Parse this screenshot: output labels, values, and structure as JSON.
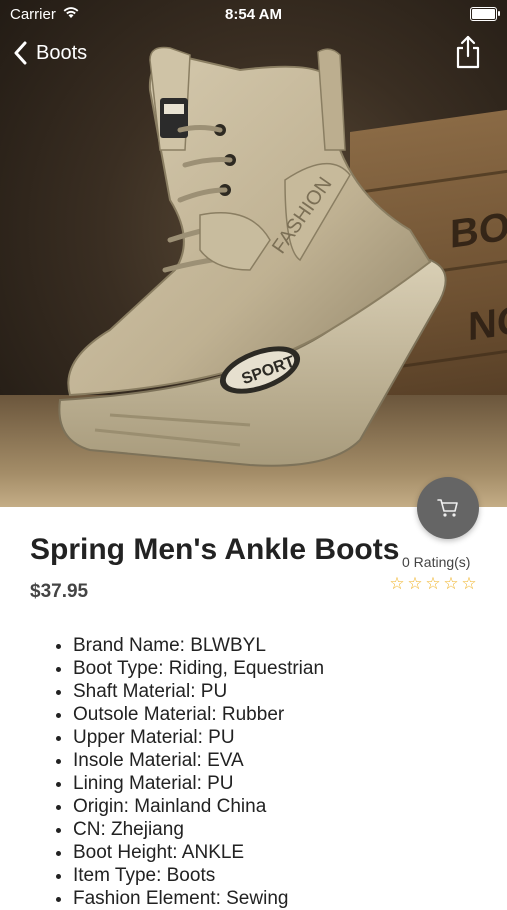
{
  "status_bar": {
    "carrier": "Carrier",
    "time": "8:54 AM"
  },
  "nav": {
    "back_label": "Boots",
    "share_icon": "share-icon"
  },
  "hero": {
    "crate_text_top": "BOX",
    "crate_text_bottom": "NO"
  },
  "product": {
    "title": "Spring Men's Ankle Boots",
    "price": "$37.95",
    "rating_count": "0 Rating(s)",
    "stars": [
      "☆",
      "☆",
      "☆",
      "☆",
      "☆"
    ],
    "cart_icon": "cart-icon",
    "features": [
      "Brand Name: BLWBYL",
      "Boot Type: Riding, Equestrian",
      "Shaft Material: PU",
      "Outsole Material: Rubber",
      "Upper Material: PU",
      "Insole Material: EVA",
      "Lining Material: PU",
      "Origin: Mainland China",
      "CN: Zhejiang",
      "Boot Height: ANKLE",
      "Item Type: Boots",
      "Fashion Element: Sewing"
    ]
  },
  "colors": {
    "cart_fab": "#656565",
    "star": "#f0b429",
    "text": "#222222"
  }
}
